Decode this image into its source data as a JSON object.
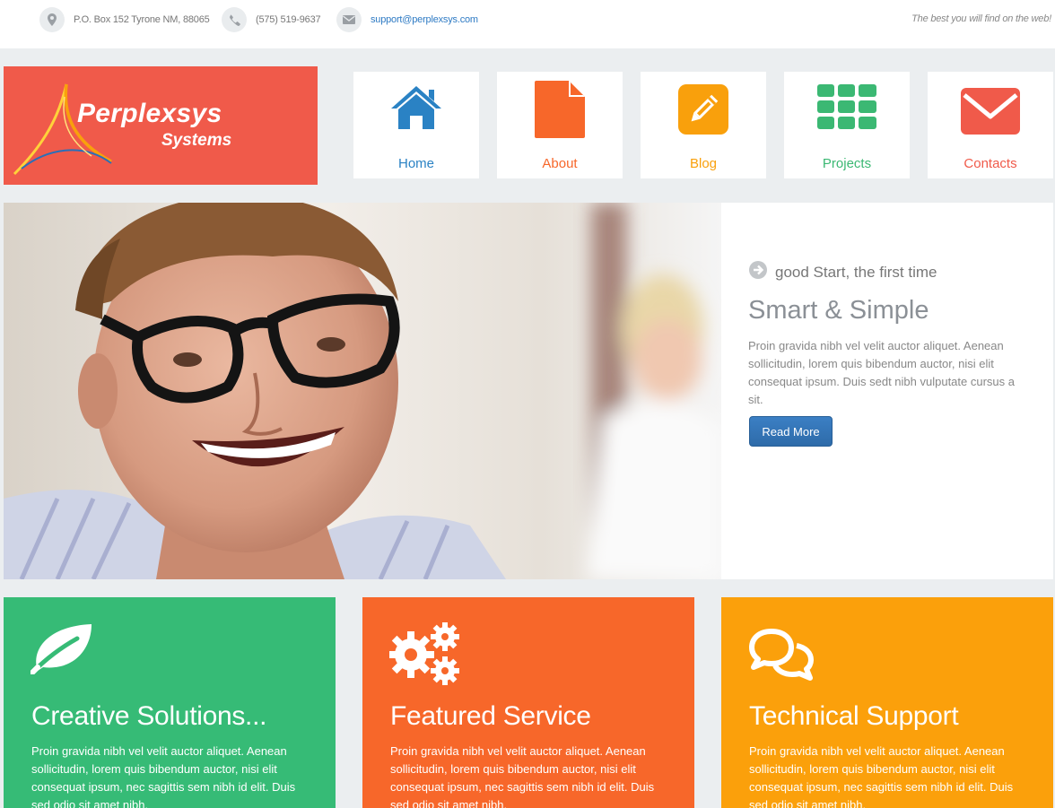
{
  "topbar": {
    "address": "P.O. Box 152 Tyrone NM, 88065",
    "phone": "(575) 519-9637",
    "email": "support@perplexsys.com",
    "tagline": "The best you will find on the web!"
  },
  "logo": {
    "title": "Perplexsys",
    "subtitle": "Systems"
  },
  "nav": {
    "items": [
      {
        "label": "Home",
        "icon": "home-icon",
        "color": "#2a82c4"
      },
      {
        "label": "About",
        "icon": "document-icon",
        "color": "#f7672a"
      },
      {
        "label": "Blog",
        "icon": "pencil-icon",
        "color": "#f9a00c"
      },
      {
        "label": "Projects",
        "icon": "grid-icon",
        "color": "#3bb873"
      },
      {
        "label": "Contacts",
        "icon": "mail-icon",
        "color": "#f05a4a"
      }
    ]
  },
  "hero": {
    "subtitle": "good Start, the first time",
    "title": "Smart & Simple",
    "body": "Proin gravida nibh vel velit auctor aliquet. Aenean sollicitudin, lorem quis bibendum auctor, nisi elit consequat ipsum. Duis sedt nibh vulputate cursus a sit.",
    "button": "Read More"
  },
  "features": [
    {
      "title": "Creative Solutions...",
      "body": "Proin gravida nibh vel velit auctor aliquet. Aenean sollicitudin, lorem quis bibendum auctor, nisi elit consequat ipsum, nec sagittis sem nibh id elit. Duis sed odio sit amet nibh.",
      "icon": "leaf-icon",
      "color": "#36bb76"
    },
    {
      "title": "Featured Service",
      "body": "Proin gravida nibh vel velit auctor aliquet. Aenean sollicitudin, lorem quis bibendum auctor, nisi elit consequat ipsum, nec sagittis sem nibh id elit. Duis sed odio sit amet nibh.",
      "icon": "gears-icon",
      "color": "#f7672a"
    },
    {
      "title": "Technical Support",
      "body": "Proin gravida nibh vel velit auctor aliquet. Aenean sollicitudin, lorem quis bibendum auctor, nisi elit consequat ipsum, nec sagittis sem nibh id elit. Duis sed odio sit amet nibh.",
      "icon": "chat-bubbles-icon",
      "color": "#fba00b"
    }
  ]
}
